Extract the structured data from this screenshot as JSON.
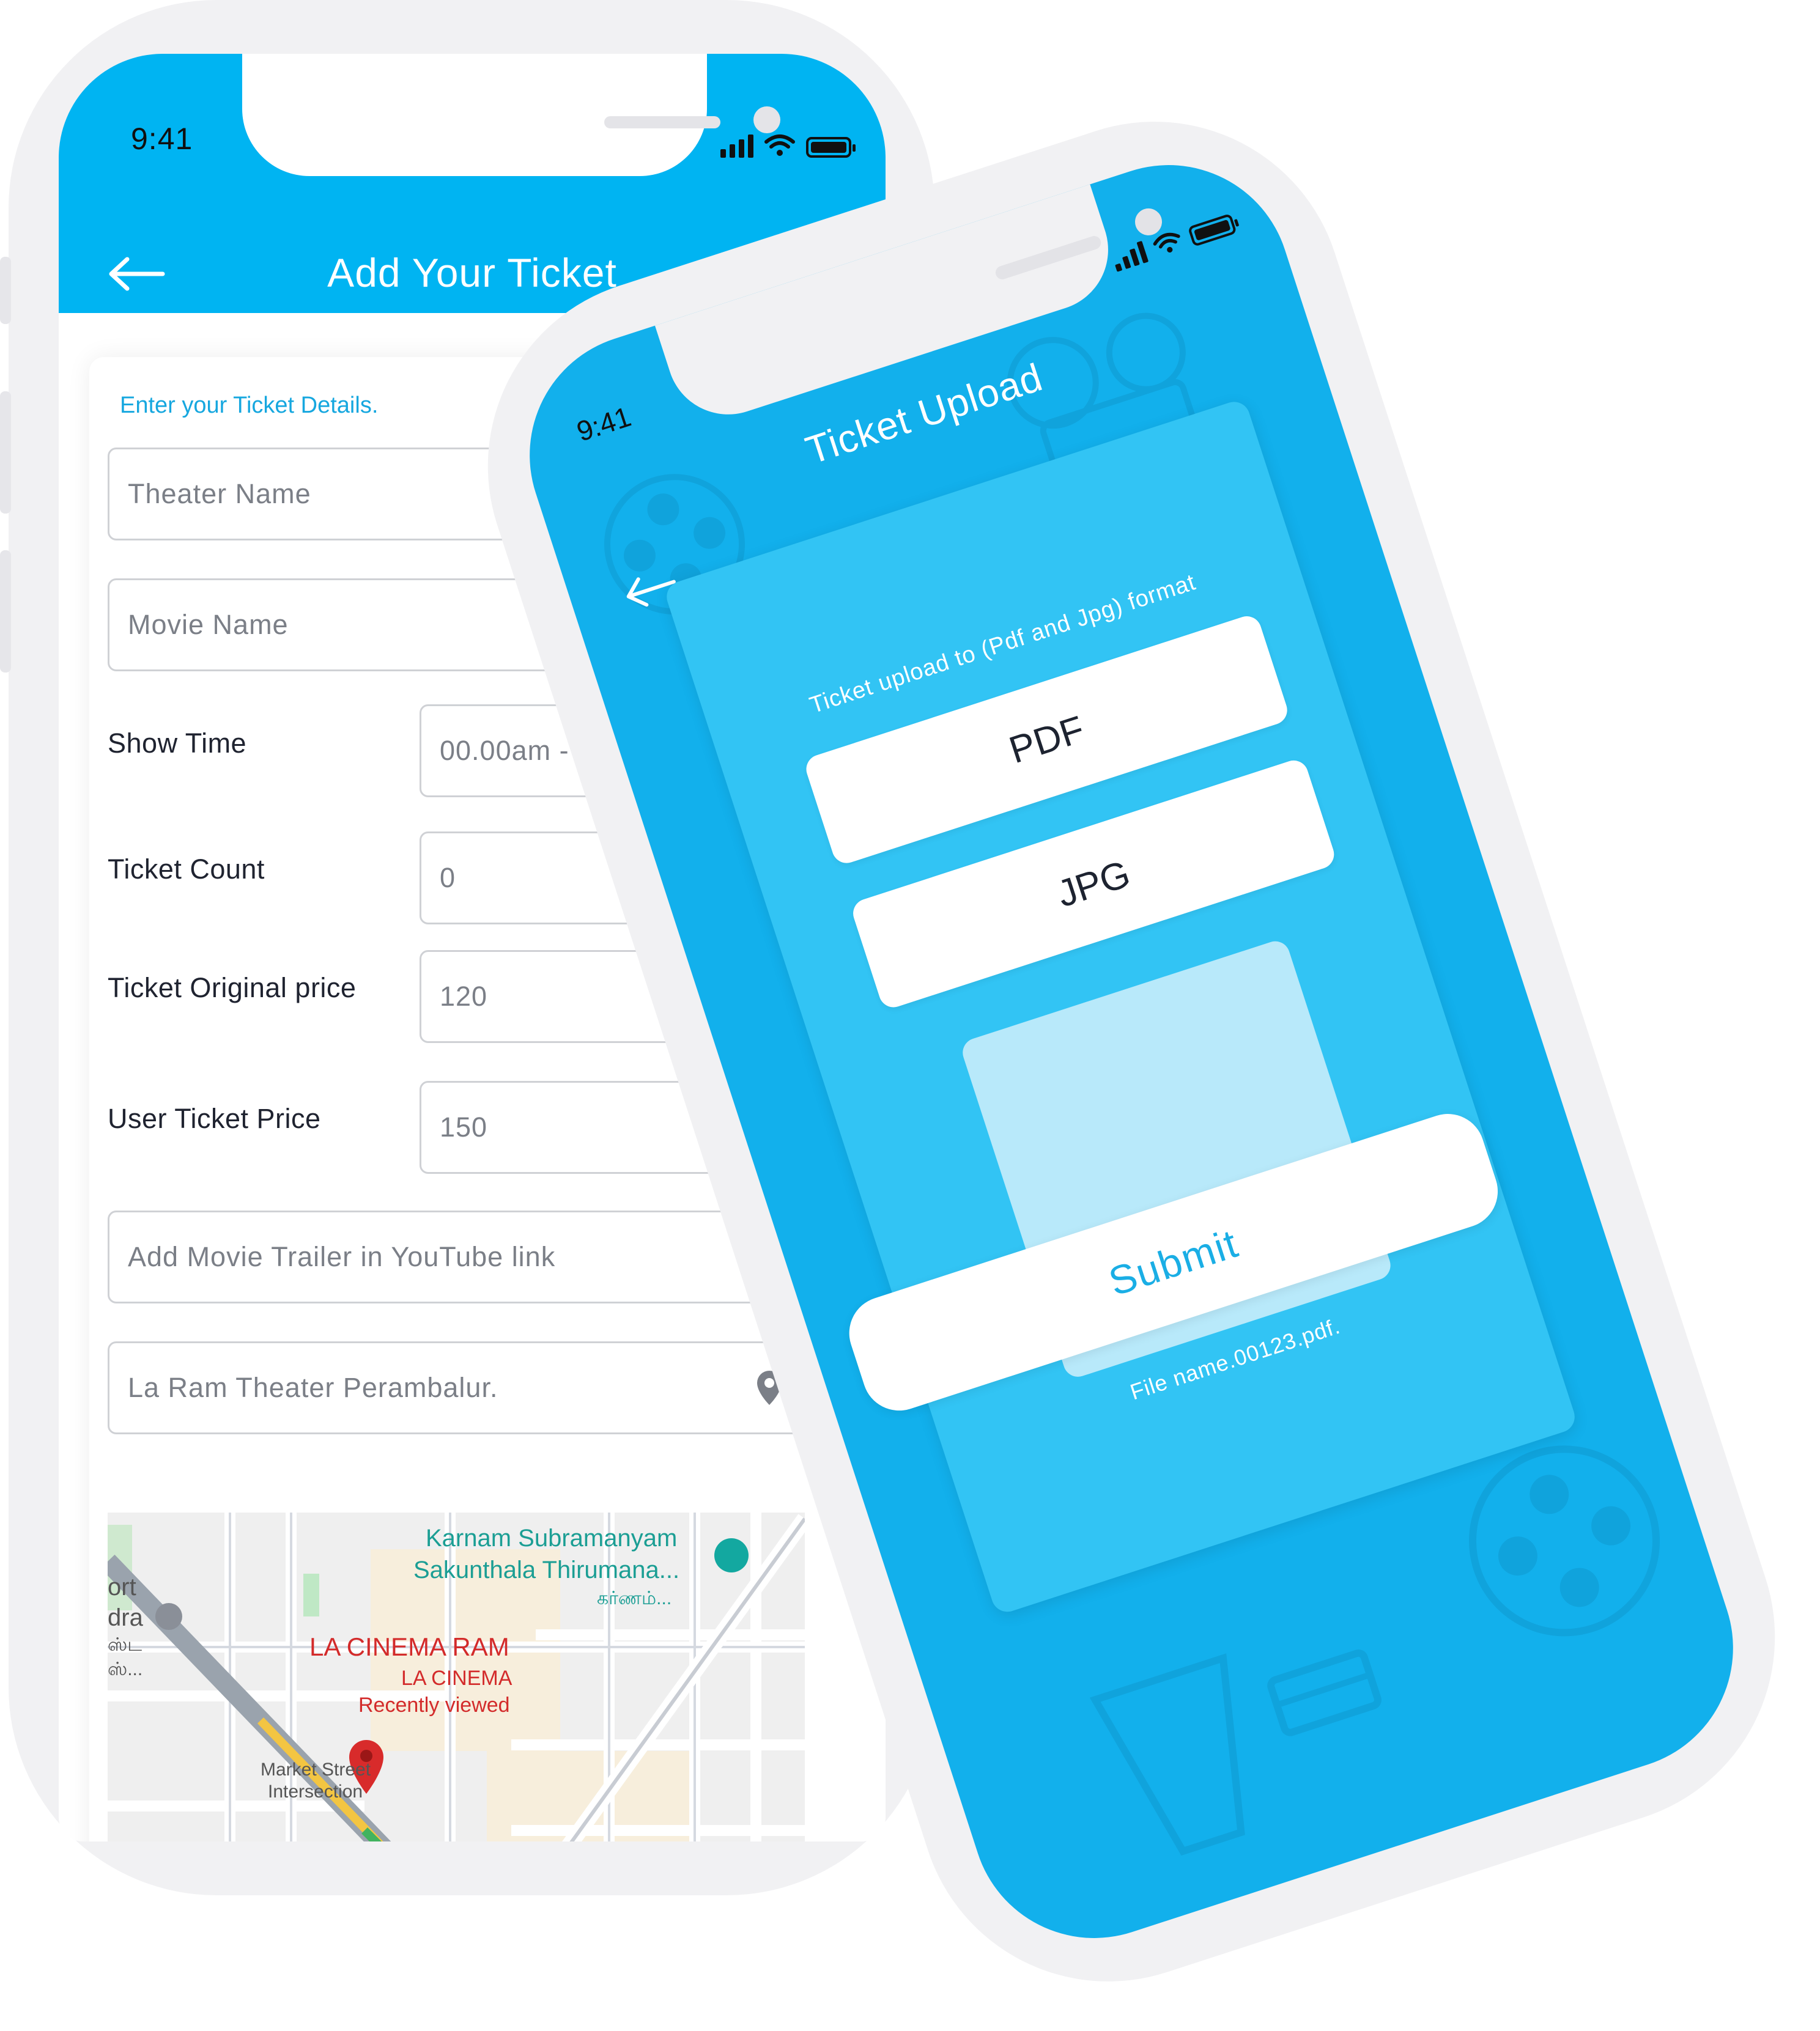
{
  "add_ticket": {
    "status_time": "9:41",
    "title": "Add Your Ticket",
    "section_label": "Enter your Ticket Details.",
    "theater_placeholder": "Theater Name",
    "movie_placeholder": "Movie Name",
    "show_time_label": "Show Time",
    "show_time_value": "00.00am - 11.01.2",
    "ticket_count_label": "Ticket Count",
    "ticket_count_value": "0",
    "original_price_label": "Ticket Original price",
    "original_price_value": "120",
    "user_price_label": "User Ticket Price",
    "user_price_value": "150",
    "currency_symbol": "₹",
    "trailer_placeholder": "Add Movie Trailer in YouTube link",
    "location_value": "La Ram Theater Perambalur.",
    "map": {
      "place1_line1": "Karnam Subramanyam",
      "place1_line2": "Sakunthala Thirumana...",
      "place1_tamil": "கர்ணம்...",
      "place2_frag1": "ort",
      "place2_frag2": "dra",
      "place2_frag3": "ஸ்ட",
      "place2_frag4": "ஸ்...",
      "cinema_name": "LA CINEMA RAM",
      "cinema_sub": "LA CINEMA",
      "recently_viewed": "Recently viewed",
      "street_line1": "Market Street",
      "street_line2": "Intersection"
    },
    "accent_color": "#00b4f2"
  },
  "ticket_upload": {
    "status_time": "9:41",
    "title": "Ticket Upload",
    "hint": "Ticket upload to (Pdf and Jpg) format",
    "pdf_button": "PDF",
    "jpg_button": "JPG",
    "file_name": "File name.00123.pdf.",
    "submit_button": "Submit",
    "accent_color": "#12b0ec"
  }
}
